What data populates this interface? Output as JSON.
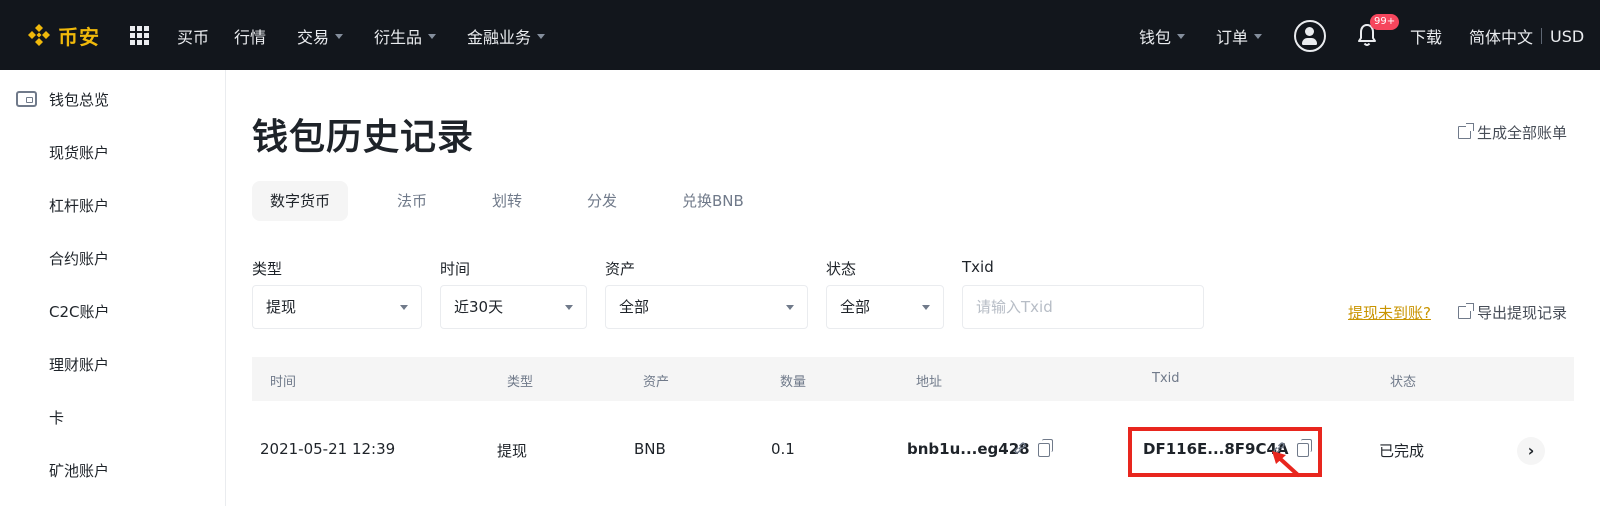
{
  "brand": {
    "name": "币安",
    "accent": "#f0b90b"
  },
  "topnav": {
    "items": [
      {
        "label": "买币",
        "has_caret": false
      },
      {
        "label": "行情",
        "has_caret": false
      },
      {
        "label": "交易",
        "has_caret": true
      },
      {
        "label": "衍生品",
        "has_caret": true
      },
      {
        "label": "金融业务",
        "has_caret": true
      }
    ],
    "right": {
      "wallet": "钱包",
      "orders": "订单",
      "notification_badge": "99+",
      "download": "下载",
      "language": "简体中文",
      "currency": "USD"
    },
    "icons": [
      "apps-grid-icon",
      "user-icon",
      "bell-icon"
    ]
  },
  "sidebar": {
    "items": [
      {
        "label": "钱包总览",
        "icon": "wallet-icon"
      },
      {
        "label": "现货账户"
      },
      {
        "label": "杠杆账户"
      },
      {
        "label": "合约账户"
      },
      {
        "label": "C2C账户"
      },
      {
        "label": "理财账户"
      },
      {
        "label": "卡"
      },
      {
        "label": "矿池账户"
      }
    ]
  },
  "main": {
    "title": "钱包历史记录",
    "generate_statement": "生成全部账单",
    "tabs": [
      {
        "label": "数字货币",
        "active": true
      },
      {
        "label": "法币"
      },
      {
        "label": "划转"
      },
      {
        "label": "分发"
      },
      {
        "label": "兑换BNB"
      }
    ],
    "filters": {
      "type": {
        "label": "类型",
        "value": "提现"
      },
      "time": {
        "label": "时间",
        "value": "近30天"
      },
      "asset": {
        "label": "资产",
        "value": "全部"
      },
      "status": {
        "label": "状态",
        "value": "全部"
      },
      "txid": {
        "label": "Txid",
        "placeholder": "请输入Txid"
      }
    },
    "help_link": "提现未到账?",
    "export_link": "导出提现记录",
    "table": {
      "columns": [
        "时间",
        "类型",
        "资产",
        "数量",
        "地址",
        "Txid",
        "状态"
      ],
      "rows": [
        {
          "time": "2021-05-21 12:39",
          "type": "提现",
          "asset": "BNB",
          "amount": "0.1",
          "address": "bnb1u...eg428",
          "txid": "DF116E...8F9C4A",
          "status": "已完成"
        }
      ]
    },
    "annotation_color": "#e8261e"
  }
}
